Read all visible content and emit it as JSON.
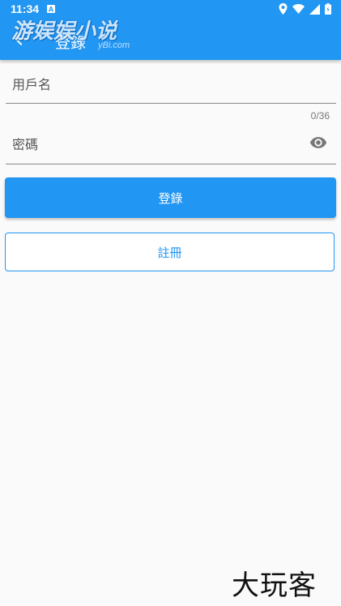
{
  "status_bar": {
    "time": "11:34"
  },
  "app_bar": {
    "title": "登錄",
    "background": "#2196f3"
  },
  "overlay": {
    "top_watermark": "游娱娱小说",
    "top_watermark_sub": "yBi.com",
    "bottom_watermark": "大玩客"
  },
  "form": {
    "username": {
      "label": "用戶名"
    },
    "password": {
      "label": "密碼",
      "counter": "0/36"
    }
  },
  "buttons": {
    "login": "登錄",
    "register": "註冊"
  },
  "colors": {
    "accent": "#2196f3",
    "background": "#fafafa"
  }
}
